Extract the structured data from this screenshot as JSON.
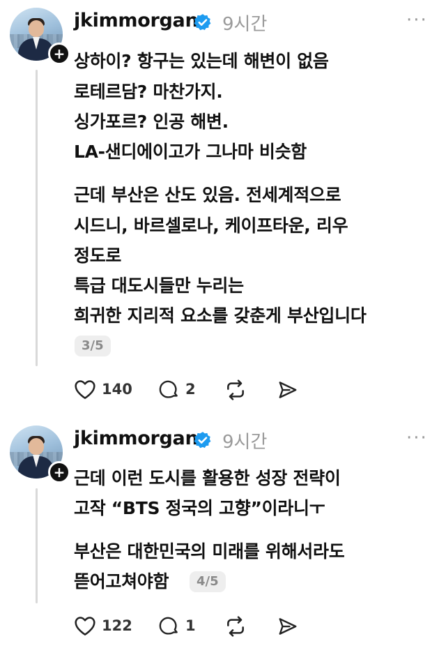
{
  "posts": [
    {
      "username": "jkimmorgan",
      "time": "9시간",
      "more": "···",
      "lines": [
        "상하이? 항구는 있는데 해변이 없음",
        "로테르담? 마찬가지.",
        "싱가포르? 인공 해변.",
        "LA-샌디에이고가 그나마 비슷함",
        "근데 부산은 산도 있음. 전세계적으로",
        "시드니, 바르셀로나, 케이프타운, 리우",
        "정도로",
        "특급 대도시들만 누리는",
        "희귀한 지리적 요소를 갖춘게 부산입니다"
      ],
      "pager": "3/5",
      "likes": "140",
      "replies": "2"
    },
    {
      "username": "jkimmorgan",
      "time": "9시간",
      "more": "···",
      "lines": [
        "근데 이런 도시를 활용한 성장 전략이",
        "고작 “BTS 정국의 고향”이라니ㅜ",
        "부산은 대한민국의 미래를 위해서라도",
        "뜯어고쳐야함"
      ],
      "pager": "4/5",
      "likes": "122",
      "replies": "1"
    }
  ],
  "icons": {
    "verified": "verified-badge-icon",
    "like": "heart-icon",
    "reply": "comment-icon",
    "repost": "repost-icon",
    "share": "send-icon"
  },
  "colors": {
    "verified": "#1d9bf0",
    "muted": "#9a9a9a",
    "text": "#101010"
  }
}
